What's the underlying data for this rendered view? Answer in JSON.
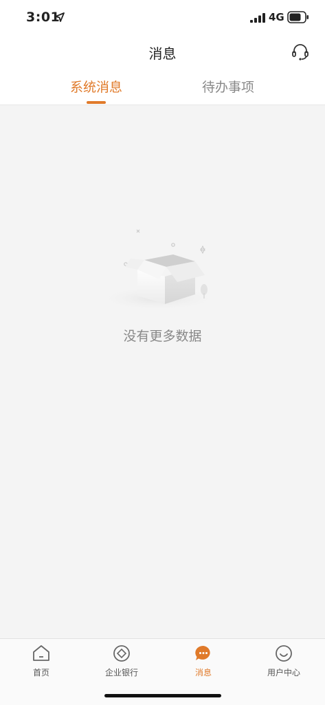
{
  "status_bar": {
    "time": "3:01",
    "network": "4G"
  },
  "nav": {
    "title": "消息"
  },
  "tabs": [
    {
      "label": "系统消息",
      "active": true
    },
    {
      "label": "待办事项",
      "active": false
    }
  ],
  "empty_state": {
    "text": "没有更多数据"
  },
  "tab_bar": {
    "items": [
      {
        "label": "首页",
        "icon": "home-icon",
        "active": false
      },
      {
        "label": "企业银行",
        "icon": "bank-icon",
        "active": false
      },
      {
        "label": "消息",
        "icon": "message-icon",
        "active": true
      },
      {
        "label": "用户中心",
        "icon": "user-center-icon",
        "active": false
      }
    ]
  },
  "colors": {
    "accent": "#e07a2a",
    "background": "#f4f4f4"
  }
}
